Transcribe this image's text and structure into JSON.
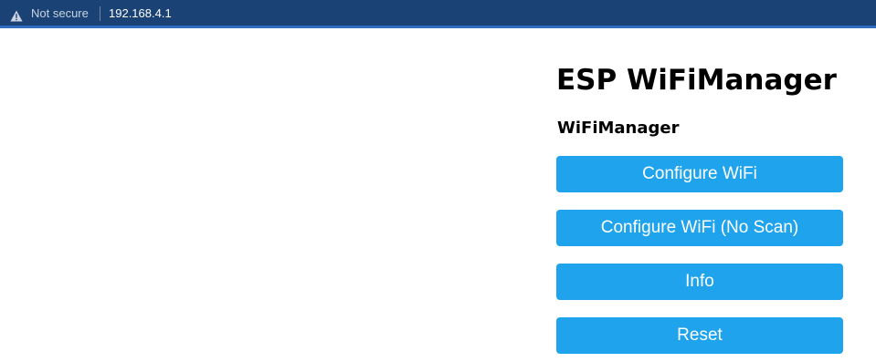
{
  "browser": {
    "security_label": "Not secure",
    "url": "192.168.4.1",
    "icons": {
      "security": "warning-triangle-icon"
    }
  },
  "page": {
    "title": "ESP WiFiManager",
    "subtitle": "WiFiManager",
    "buttons": [
      {
        "label": "Configure WiFi"
      },
      {
        "label": "Configure WiFi (No Scan)"
      },
      {
        "label": "Info"
      },
      {
        "label": "Reset"
      }
    ],
    "button_color": "#1fa3ec"
  }
}
